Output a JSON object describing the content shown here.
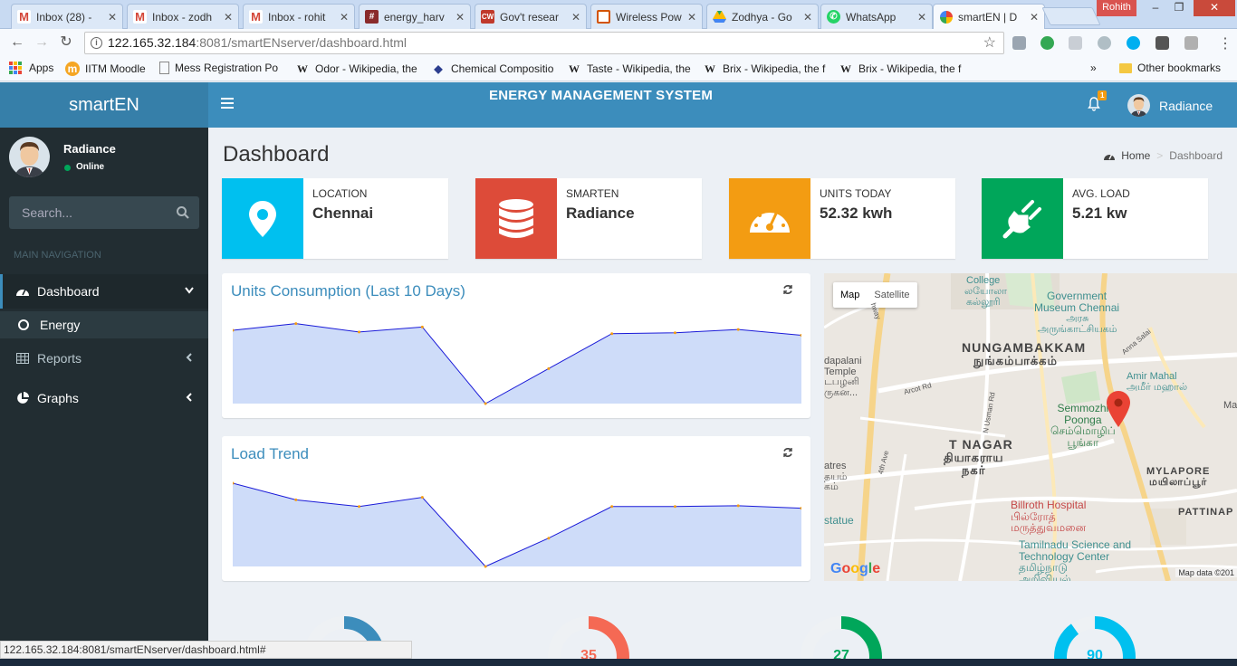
{
  "browser": {
    "tabs": [
      {
        "label": "Inbox (28) -",
        "icon": "gmail-icon",
        "color": "#d44638"
      },
      {
        "label": "Inbox - zodh",
        "icon": "gmail-icon",
        "color": "#d44638"
      },
      {
        "label": "Inbox - rohit",
        "icon": "gmail-icon",
        "color": "#d44638"
      },
      {
        "label": "energy_harv",
        "icon": "hash-icon",
        "color": "#8a2b2b"
      },
      {
        "label": "Gov't resear",
        "icon": "cw-icon",
        "color": "#c0392b"
      },
      {
        "label": "Wireless Pow",
        "icon": "chip-icon",
        "color": "#d35400"
      },
      {
        "label": "Zodhya - Go",
        "icon": "drive-icon",
        "color": "#1fa463"
      },
      {
        "label": "WhatsApp",
        "icon": "whatsapp-icon",
        "color": "#25d366"
      },
      {
        "label": "smartEN | D",
        "icon": "pinwheel-icon",
        "color": "#ea4335"
      }
    ],
    "window_user": "Rohith",
    "url_host": "122.165.32.184",
    "url_path": ":8081/smartENserver/dashboard.html",
    "bookmarks": [
      {
        "label": "Apps"
      },
      {
        "label": "IITM Moodle"
      },
      {
        "label": "Mess Registration Po"
      },
      {
        "label": "Odor - Wikipedia, the"
      },
      {
        "label": "Chemical Compositio"
      },
      {
        "label": "Taste - Wikipedia, the"
      },
      {
        "label": "Brix - Wikipedia, the f"
      },
      {
        "label": "Brix - Wikipedia, the f"
      }
    ],
    "other_bookmarks": "Other bookmarks",
    "status_url": "122.165.32.184:8081/smartENserver/dashboard.html#"
  },
  "header": {
    "logo": "smartEN",
    "system_title": "ENERGY MANAGEMENT SYSTEM",
    "notification_count": "1",
    "user_name": "Radiance"
  },
  "sidebar": {
    "user_name": "Radiance",
    "status": "Online",
    "search_placeholder": "Search...",
    "nav_header": "MAIN NAVIGATION",
    "items": [
      {
        "label": "Dashboard"
      },
      {
        "label": "Energy"
      },
      {
        "label": "Reports"
      },
      {
        "label": "Graphs"
      }
    ]
  },
  "page": {
    "title": "Dashboard",
    "breadcrumb_home": "Home",
    "breadcrumb_current": "Dashboard"
  },
  "info_boxes": [
    {
      "label": "LOCATION",
      "value": "Chennai",
      "color": "#00c0ef",
      "icon": "map-marker-icon"
    },
    {
      "label": "SMARTEN",
      "value": "Radiance",
      "color": "#dd4b39",
      "icon": "database-icon"
    },
    {
      "label": "UNITS TODAY",
      "value": "52.32 kwh",
      "color": "#f39c12",
      "icon": "dashboard-gauge-icon"
    },
    {
      "label": "AVG. LOAD",
      "value": "5.21 kw",
      "color": "#00a65a",
      "icon": "plug-icon"
    }
  ],
  "charts": {
    "units_title": "Units Consumption (Last 10 Days)",
    "load_title": "Load Trend"
  },
  "chart_data": [
    {
      "type": "area",
      "title": "Units Consumption (Last 10 Days)",
      "values": [
        88,
        96,
        86,
        92,
        0,
        42,
        84,
        85,
        89,
        82
      ],
      "ylim": [
        0,
        100
      ],
      "xlabel": "",
      "ylabel": "",
      "grid": false
    },
    {
      "type": "area",
      "title": "Load Trend",
      "values": [
        100,
        80,
        72,
        83,
        0,
        34,
        72,
        72,
        73,
        70
      ],
      "ylim": [
        0,
        100
      ],
      "xlabel": "",
      "ylabel": "",
      "grid": false
    }
  ],
  "map": {
    "type_map": "Map",
    "type_satellite": "Satellite",
    "credit": "Map data ©201",
    "labels": {
      "college": "College",
      "college_ta1": "லயோலா",
      "college_ta2": "கல்லூரி",
      "museum": "Government\nMuseum Chennai",
      "museum_ta": "அரசு\nஅருங்காட்சியகம்",
      "nungambakkam": "NUNGAMBAKKAM",
      "nungambakkam_ta": "நுங்கம்பாக்கம்",
      "vadapalani": "dapalani\nTemple\nடபழனி\nருகன...",
      "amir": "Amir Mahal\nஅமீர் மஹால்",
      "semmozhi": "Semmozhi\nPoonga\nசெம்மொழிப்\nபூங்கா",
      "tnagar": "T NAGAR",
      "tnagar_ta": "தியாகராய\nநகர்",
      "theatres": "atres\nதயம்\nகம்",
      "mylapore": "MYLAPORE\nமயிலாப்பூர்",
      "billroth": "Billroth Hospital\nபில்ரோத்\nமருத்துவமனை",
      "pattinap": "PATTINAP",
      "statue": "statue",
      "science": "Tamilnadu Science and\nTechnology Center\nதமிழ்நாடு\nஅறிவியல்",
      "arcot": "Arcot Rd",
      "usman": "N Usman Rd",
      "fourth": "4th Ave",
      "anna": "Anna Salai",
      "way": "hway",
      "ma": "Ma"
    }
  },
  "gauges": [
    {
      "value": "",
      "fraction": 0.25,
      "color": "#3c8dbc"
    },
    {
      "value": "35",
      "fraction": 0.35,
      "color": "#f56954"
    },
    {
      "value": "27",
      "fraction": 0.27,
      "color": "#00a65a"
    },
    {
      "value": "90",
      "fraction": 0.9,
      "color": "#00c0ef"
    }
  ]
}
